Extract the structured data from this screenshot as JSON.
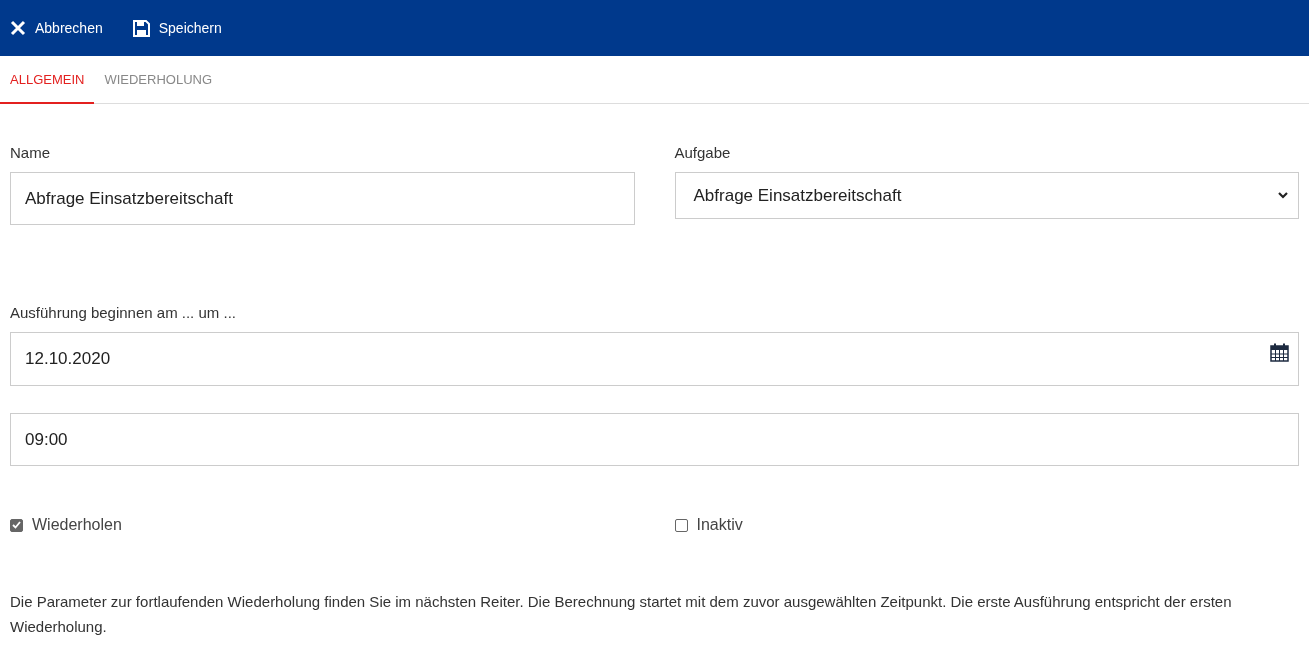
{
  "toolbar": {
    "buttons": [
      {
        "kind": "cancel",
        "label": "Abbrechen"
      },
      {
        "kind": "save",
        "label": "Speichern"
      }
    ]
  },
  "tabs": [
    {
      "label": "ALLGEMEIN",
      "selected": true
    },
    {
      "label": "WIEDERHOLUNG",
      "selected": false
    }
  ],
  "name_field": {
    "label": "Name",
    "value": "Abfrage Einsatzbereitschaft"
  },
  "task_select": {
    "label": "Aufgabe",
    "value": "Abfrage Einsatzbereitschaft"
  },
  "start": {
    "label": "Ausführung beginnen am ... um ...",
    "date": "12.10.2020",
    "time": "09:00"
  },
  "checkboxes": [
    {
      "label": "Wiederholen",
      "checked": true
    },
    {
      "label": "Inaktiv",
      "checked": false
    }
  ],
  "note": "Die Parameter zur fortlaufenden Wiederholung finden Sie im nächsten Reiter. Die Berechnung startet mit dem zuvor ausgewählten Zeitpunkt. Die erste Ausführung entspricht der ersten Wiederholung."
}
